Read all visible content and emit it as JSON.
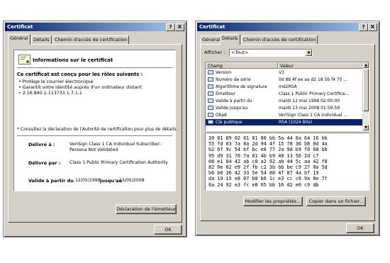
{
  "left": {
    "title": "Certificat",
    "help_btn": "?",
    "close_btn": "X",
    "tabs": [
      "Général",
      "Détails",
      "Chemin d'accès de certification"
    ],
    "info_heading": "Informations sur le certificat",
    "purpose_heading": "Ce certificat est conçu pour les rôles suivants :",
    "purposes": [
      "• Protège le courrier électronique",
      "• Garantit votre identité auprès d'un ordinateur distant",
      "• 2.16.840.1.113733.1.7.1.1"
    ],
    "note": "* Consultez la déclaration de l'Autorité de certification pour plus de détails.",
    "issued_to_label": "Délivré à :",
    "issued_to_value_1": "VeriSign Class 1 CA Individual Subscriber-",
    "issued_to_value_2": "Persona Not Validated",
    "issued_by_label": "Délivré par :",
    "issued_by_value": "Class 1 Public Primary Certification Authority",
    "valid_from_label": "Valide à partir du",
    "valid_from_value": "12/05/1998",
    "valid_to_label": "jusqu'au",
    "valid_to_value": "13/05/2008",
    "issuer_stmt_btn": "Déclaration de l'émetteur",
    "ok_btn": "OK"
  },
  "right": {
    "title": "Certificat",
    "help_btn": "?",
    "close_btn": "X",
    "tabs": [
      "Général",
      "Détails",
      "Chemin d'accès de certification"
    ],
    "show_label": "Afficher :",
    "show_value": "<Tout>",
    "col_field": "Champ",
    "col_value": "Valeur",
    "rows": [
      {
        "field": "Version",
        "value": "V3"
      },
      {
        "field": "Numéro de série",
        "value": "0d 8b 4f ee aa d2 18 5b f4 75 ..."
      },
      {
        "field": "Algorithme de signature",
        "value": "md2RSA"
      },
      {
        "field": "Émetteur",
        "value": "Class 1 Public Primary Certifica..."
      },
      {
        "field": "Valide à partir du",
        "value": "mardi 12 mai 1998 02:00:00"
      },
      {
        "field": "Valide jusqu'au",
        "value": "mardi 13 mai 2008 01:59:59"
      },
      {
        "field": "Objet",
        "value": "VeriSign Class 1 CA Individual ..."
      },
      {
        "field": "Clé publique",
        "value": "RSA (1024 Bits)"
      }
    ],
    "hex_lines": [
      "30 81 89 02 81 81 00 bb 5a 44 8a 64 16 bb",
      "55 fd 03 7a 8a 2d 94 4f 15 78 36 b8 0d 4a",
      "b2 6f 9c 54 bf bc e8 77 2a 9d b9 f0 68 bb",
      "95 d9 31 70 7a 81 4b b9 48 13 56 2d c7",
      "08 e1 84 42 ab c0 a2 92 ab 44 5c aa 42 f0",
      "82 0e 02 e9 2f fb c2 3b bb be c9 27 0a 5d",
      "b6 b0 36 42 33 5e 54 88 4f 87 4a bf 19",
      "da 19 15 e8 07 b8 b6 1c e3 cc c6 9a 8e 7f",
      "6a 24 92 e3 fc e0 65 bb 16 d2 e0 c9 db"
    ],
    "modify_btn": "Modifier les propriétés...",
    "copy_btn": "Copier dans un fichier...",
    "ok_btn": "OK"
  }
}
